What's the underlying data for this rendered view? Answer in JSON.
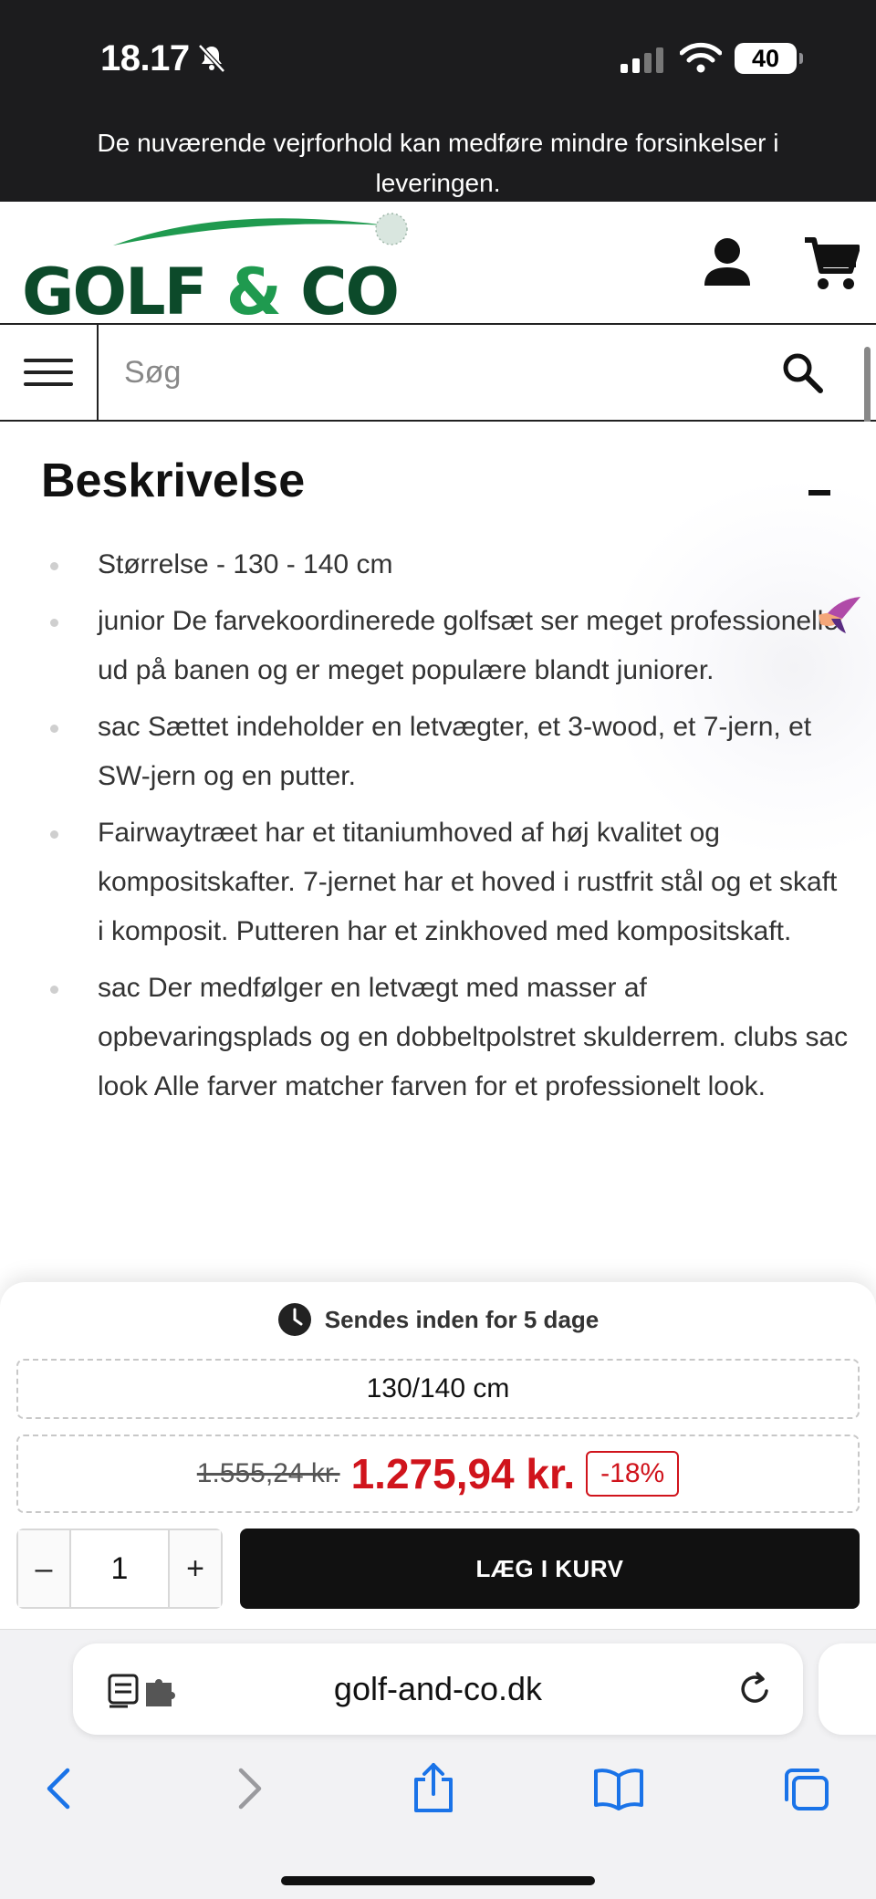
{
  "status_bar": {
    "time": "18.17",
    "battery": "40"
  },
  "notice": {
    "text": "De nuværende vejrforhold kan medføre mindre forsinkelser i leveringen."
  },
  "header": {
    "logo_text_a": "GOLF ",
    "logo_amp": "&",
    "logo_text_b": " CO"
  },
  "search": {
    "placeholder": "Søg"
  },
  "description": {
    "title": "Beskrivelse",
    "items": [
      "Størrelse - 130 - 140 cm",
      "junior De farvekoordinerede golfsæt ser meget professionelle ud på banen og er meget populære blandt juniorer.",
      "sac Sættet indeholder en letvægter, et 3-wood, et 7-jern, et SW-jern og en putter.",
      "Fairwaytræet har et titaniumhoved af høj kvalitet og kompositskafter. 7-jernet har et hoved i rustfrit stål og et skaft i komposit. Putteren har et zinkhoved med kompositskaft.",
      "sac Der medfølger en letvægt med masser af opbevaringsplads og en dobbeltpolstret skulderrem. clubs sac look Alle farver matcher farven for et professionelt look."
    ]
  },
  "buy": {
    "shipping": "Sendes inden for 5 dage",
    "size": "130/140 cm",
    "old_price": "1.555,24 kr.",
    "new_price": "1.275,94 kr.",
    "discount": "-18%",
    "qty_minus": "–",
    "qty_value": "1",
    "qty_plus": "+",
    "add_to_cart": "LÆG I KURV"
  },
  "browser": {
    "url": "golf-and-co.dk"
  },
  "colors": {
    "brand_dark_green": "#0c4a2a",
    "brand_green": "#1f9a4f",
    "sale_red": "#d0141c",
    "ios_blue": "#1a73e8"
  }
}
